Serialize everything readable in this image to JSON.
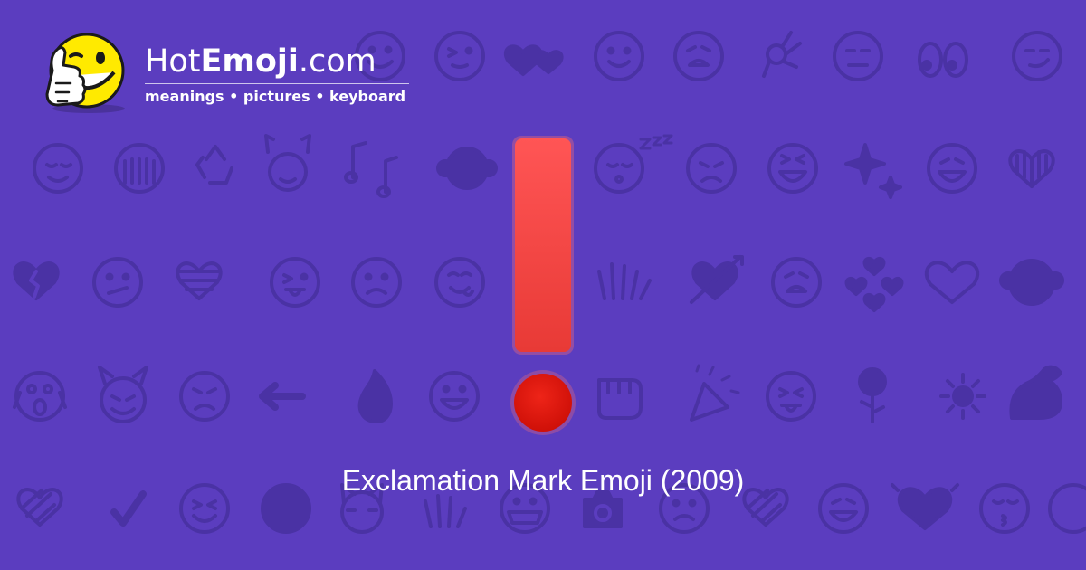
{
  "brand": {
    "name_prefix": "Hot",
    "name_strong": "Emoji",
    "name_suffix": ".com",
    "tagline": "meanings • pictures • keyboard"
  },
  "background_pattern": {
    "icons": [
      "grinning-face-icon",
      "winking-face-icon",
      "kissing-face-icon",
      "two-hearts-icon",
      "smiling-face-icon",
      "weary-face-icon",
      "ok-hand-icon",
      "neutral-face-icon",
      "eyes-icon",
      "smirking-face-icon",
      "relieved-face-icon",
      "face-with-covered-mouth-icon",
      "recycle-icon",
      "raising-hands-icon",
      "musical-notes-icon",
      "see-no-evil-monkey-icon",
      "sleeping-face-icon",
      "sad-face-icon",
      "laughing-face-icon",
      "sparkles-icon",
      "striped-heart-icon",
      "broken-heart-icon",
      "confused-face-icon",
      "tongue-out-face-icon",
      "frowning-face-icon",
      "waving-hand-icon",
      "heart-with-arrow-icon",
      "revolving-hearts-icon",
      "heart-icon",
      "monkey-icon",
      "screaming-face-icon",
      "smiling-imp-icon",
      "angry-face-icon",
      "left-arrow-icon",
      "fire-icon",
      "punch-icon",
      "party-popper-icon",
      "rose-icon",
      "sun-icon",
      "flexed-biceps-icon",
      "check-mark-icon",
      "squinting-face-icon",
      "moon-face-icon",
      "cat-face-icon",
      "medical-mask-face-icon",
      "camera-icon",
      "beaming-face-icon",
      "kissing-closed-eyes-icon"
    ]
  },
  "emoji": {
    "name": "exclamation-mark-icon",
    "bar_color": "#ff4d4d",
    "dot_color": "#dd1a10"
  },
  "caption": {
    "text": "Exclamation Mark Emoji (2009)"
  },
  "colors": {
    "background": "#5b3dbf",
    "pattern": "#4a32a4",
    "mascot": "#ffea00"
  }
}
